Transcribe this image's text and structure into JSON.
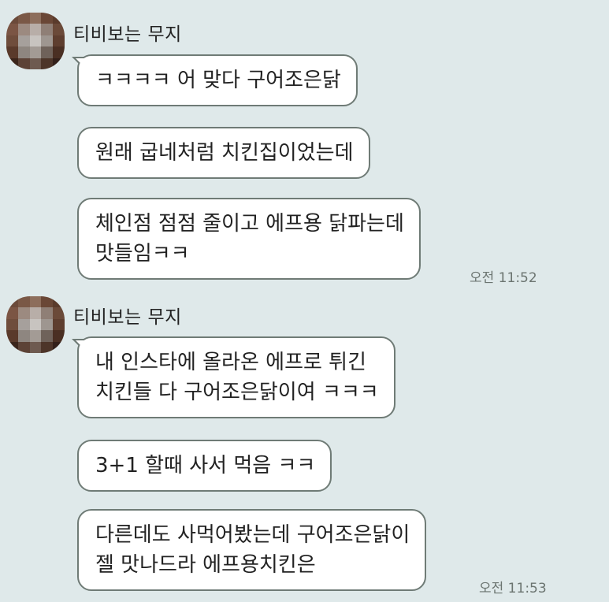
{
  "chat": {
    "groups": [
      {
        "sender": "티비보는 무지",
        "messages": [
          "ㅋㅋㅋㅋ 어 맞다 구어조은닭",
          "원래 굽네처럼 치킨집이었는데",
          "체인점 점점 줄이고 에프용 닭파는데\n맛들임ㅋㅋ"
        ],
        "time": "오전 11:52"
      },
      {
        "sender": "티비보는 무지",
        "messages": [
          "내 인스타에 올라온 에프로 튀긴\n치킨들 다 구어조은닭이여 ㅋㅋㅋ",
          "3+1 할때 사서 먹음 ㅋㅋ",
          "다른데도 사먹어봤는데 구어조은닭이\n젤 맛나드라 에프용치킨은"
        ],
        "time": "오전 11:53"
      }
    ]
  },
  "colors": {
    "background": "#dfe9ea",
    "bubble": "#ffffff",
    "bubble_border": "#6f7b76",
    "time_text": "#6b7470"
  },
  "icons": {
    "avatar": "pixelated-profile-avatar"
  }
}
